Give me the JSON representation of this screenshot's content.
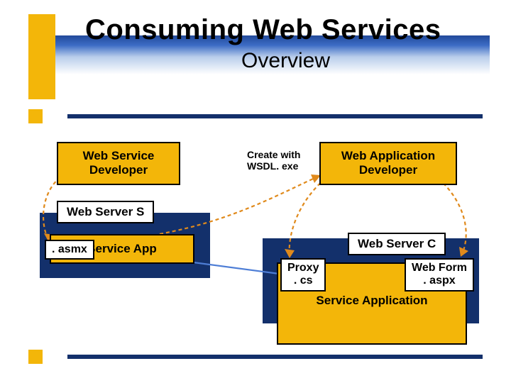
{
  "title": "Consuming Web Services",
  "subtitle": "Overview",
  "developers": {
    "ws": "Web Service\nDeveloper",
    "wa": "Web Application\nDeveloper"
  },
  "wsdl_label": "Create with\nWSDL. exe",
  "server_s": {
    "title": "Web Server S",
    "asmx": ". asmx",
    "service_app": "Service App"
  },
  "server_c": {
    "title": "Web Server C",
    "proxy": "Proxy\n. cs",
    "webform": "Web Form\n. aspx",
    "service_app": "Service Application"
  },
  "colors": {
    "yellow": "#f3b609",
    "navy": "#13306b",
    "orange_dash": "#e08a1c",
    "blue_arrow": "#4e7ed6"
  }
}
